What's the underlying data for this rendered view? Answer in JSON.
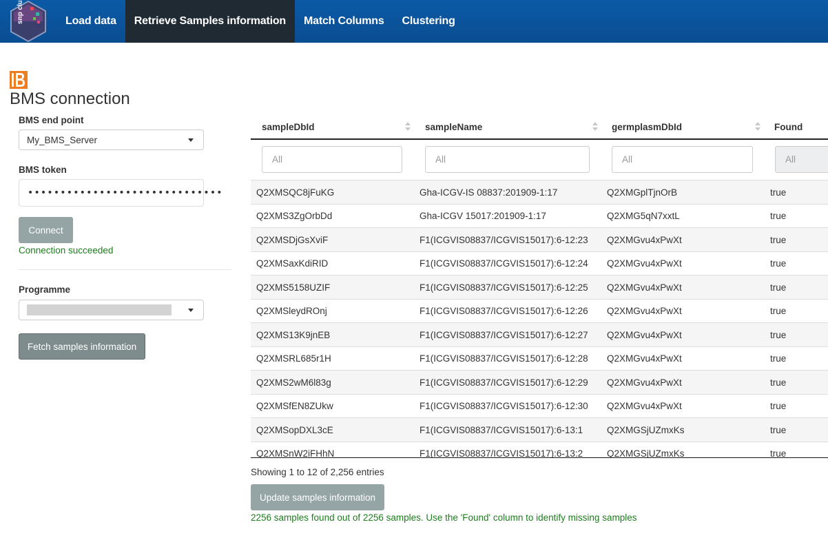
{
  "nav": {
    "logo_text": "snp clust",
    "items": [
      "Load data",
      "Retrieve Samples information",
      "Match Columns",
      "Clustering"
    ],
    "active_index": 1
  },
  "page": {
    "title": "BMS connection",
    "header_icon": "brapi-b-logo-icon"
  },
  "form": {
    "endpoint_label": "BMS end point",
    "endpoint_value": "My_BMS_Server",
    "token_label": "BMS token",
    "token_value": "••••••••••••••••••••••••••••••",
    "connect_label": "Connect",
    "connection_status": "Connection succeeded",
    "programme_label": "Programme",
    "fetch_label": "Fetch samples information"
  },
  "table": {
    "columns": [
      "sampleDbId",
      "sampleName",
      "germplasmDbId",
      "Found"
    ],
    "filter_placeholder": "All",
    "rows": [
      [
        "Q2XMSQC8jFuKG",
        "Gha-ICGV-IS 08837:201909-1:17",
        "Q2XMGplTjnOrB",
        "true"
      ],
      [
        "Q2XMS3ZgOrbDd",
        "Gha-ICGV 15017:201909-1:17",
        "Q2XMG5qN7xxtL",
        "true"
      ],
      [
        "Q2XMSDjGsXviF",
        "F1(ICGVIS08837/ICGVIS15017):6-12:23",
        "Q2XMGvu4xPwXt",
        "true"
      ],
      [
        "Q2XMSaxKdiRID",
        "F1(ICGVIS08837/ICGVIS15017):6-12:24",
        "Q2XMGvu4xPwXt",
        "true"
      ],
      [
        "Q2XMS5158UZIF",
        "F1(ICGVIS08837/ICGVIS15017):6-12:25",
        "Q2XMGvu4xPwXt",
        "true"
      ],
      [
        "Q2XMSleydROnj",
        "F1(ICGVIS08837/ICGVIS15017):6-12:26",
        "Q2XMGvu4xPwXt",
        "true"
      ],
      [
        "Q2XMS13K9jnEB",
        "F1(ICGVIS08837/ICGVIS15017):6-12:27",
        "Q2XMGvu4xPwXt",
        "true"
      ],
      [
        "Q2XMSRL685r1H",
        "F1(ICGVIS08837/ICGVIS15017):6-12:28",
        "Q2XMGvu4xPwXt",
        "true"
      ],
      [
        "Q2XMS2wM6l83g",
        "F1(ICGVIS08837/ICGVIS15017):6-12:29",
        "Q2XMGvu4xPwXt",
        "true"
      ],
      [
        "Q2XMSfEN8ZUkw",
        "F1(ICGVIS08837/ICGVIS15017):6-12:30",
        "Q2XMGvu4xPwXt",
        "true"
      ],
      [
        "Q2XMSopDXL3cE",
        "F1(ICGVIS08837/ICGVIS15017):6-13:1",
        "Q2XMGSjUZmxKs",
        "true"
      ],
      [
        "Q2XMSnW2iFHhN",
        "F1(ICGVIS08837/ICGVIS15017):6-13:2",
        "Q2XMGSjUZmxKs",
        "true"
      ]
    ]
  },
  "footer": {
    "entries_info": "Showing 1 to 12 of 2,256 entries",
    "update_label": "Update samples information",
    "found_status": "2256 samples found out of 2256 samples. Use the 'Found' column to identify missing samples"
  },
  "colors": {
    "navbar": "#0a4d92",
    "nav_active": "#1f2a33",
    "success": "#1e7d1e",
    "button": "#95a5a6"
  }
}
